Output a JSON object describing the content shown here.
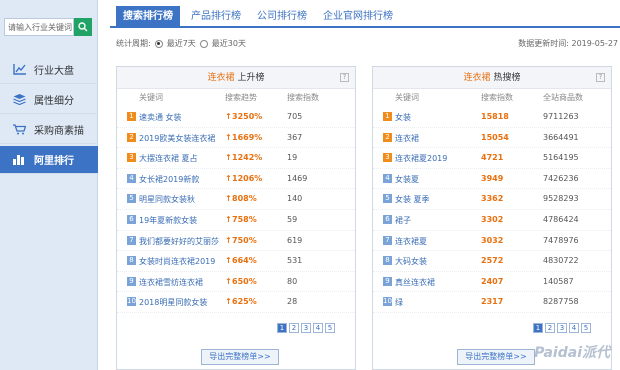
{
  "sidebar": {
    "search_placeholder": "请输入行业关键词",
    "items": [
      {
        "label": "行业大盘",
        "icon": "chart-icon",
        "active": false
      },
      {
        "label": "属性细分",
        "icon": "layers-icon",
        "active": false
      },
      {
        "label": "采购商素描",
        "icon": "cart-icon",
        "active": false
      },
      {
        "label": "阿里排行",
        "icon": "bar-rank-icon",
        "active": true
      }
    ]
  },
  "tabs": [
    {
      "label": "搜索排行榜",
      "active": true
    },
    {
      "label": "产品排行榜",
      "active": false
    },
    {
      "label": "公司排行榜",
      "active": false
    },
    {
      "label": "企业官网排行榜",
      "active": false
    }
  ],
  "filter": {
    "label": "统计周期:",
    "option1": "最近7天",
    "option2": "最近30天",
    "selected": "最近7天"
  },
  "update_time": "数据更新时间: 2019-05-27",
  "left_panel": {
    "keyword": "连衣裙",
    "title": "上升榜",
    "columns": [
      "关键词",
      "搜索趋势",
      "搜索指数"
    ],
    "rows": [
      {
        "rank": "1",
        "keyword": "速卖通 女装",
        "trend": "3250%",
        "index": "705"
      },
      {
        "rank": "2",
        "keyword": "2019欧美女装连衣裙",
        "trend": "1669%",
        "index": "367"
      },
      {
        "rank": "3",
        "keyword": "大摆连衣裙 夏占",
        "trend": "1242%",
        "index": "19"
      },
      {
        "rank": "4",
        "keyword": "女长裙2019新款",
        "trend": "1206%",
        "index": "1469"
      },
      {
        "rank": "5",
        "keyword": "明星同款女装秋",
        "trend": "808%",
        "index": "140"
      },
      {
        "rank": "6",
        "keyword": "19年夏新款女装",
        "trend": "758%",
        "index": "59"
      },
      {
        "rank": "7",
        "keyword": "我们都要好好的艾丽莎",
        "trend": "750%",
        "index": "619"
      },
      {
        "rank": "8",
        "keyword": "女装时尚连衣裙2019",
        "trend": "664%",
        "index": "531"
      },
      {
        "rank": "9",
        "keyword": "连衣裙雪纺连衣裙",
        "trend": "650%",
        "index": "80"
      },
      {
        "rank": "10",
        "keyword": "2018明星同款女装",
        "trend": "625%",
        "index": "28"
      }
    ],
    "pages": [
      "1",
      "2",
      "3",
      "4",
      "5"
    ],
    "export_label": "导出完整榜单>>"
  },
  "right_panel": {
    "keyword": "连衣裙",
    "title": "热搜榜",
    "columns": [
      "关键词",
      "搜索指数",
      "全站商品数"
    ],
    "rows": [
      {
        "rank": "1",
        "keyword": "女装",
        "index": "15818",
        "count": "9711263"
      },
      {
        "rank": "2",
        "keyword": "连衣裙",
        "index": "15054",
        "count": "3664491"
      },
      {
        "rank": "3",
        "keyword": "连衣裙夏2019",
        "index": "4721",
        "count": "5164195"
      },
      {
        "rank": "4",
        "keyword": "女装夏",
        "index": "3949",
        "count": "7426236"
      },
      {
        "rank": "5",
        "keyword": "女装 夏季",
        "index": "3362",
        "count": "9528293"
      },
      {
        "rank": "6",
        "keyword": "裙子",
        "index": "3302",
        "count": "4786424"
      },
      {
        "rank": "7",
        "keyword": "连衣裙夏",
        "index": "3032",
        "count": "7478976"
      },
      {
        "rank": "8",
        "keyword": "大码女装",
        "index": "2572",
        "count": "4830722"
      },
      {
        "rank": "9",
        "keyword": "真丝连衣裙",
        "index": "2407",
        "count": "140587"
      },
      {
        "rank": "10",
        "keyword": "绿",
        "index": "2317",
        "count": "8287758"
      }
    ],
    "pages": [
      "1",
      "2",
      "3",
      "4",
      "5"
    ],
    "export_label": "导出完整榜单>>"
  },
  "watermark": "Paidai派代",
  "colors": {
    "accent": "#3c73c4",
    "orange": "#e8700f",
    "green": "#21a366"
  }
}
